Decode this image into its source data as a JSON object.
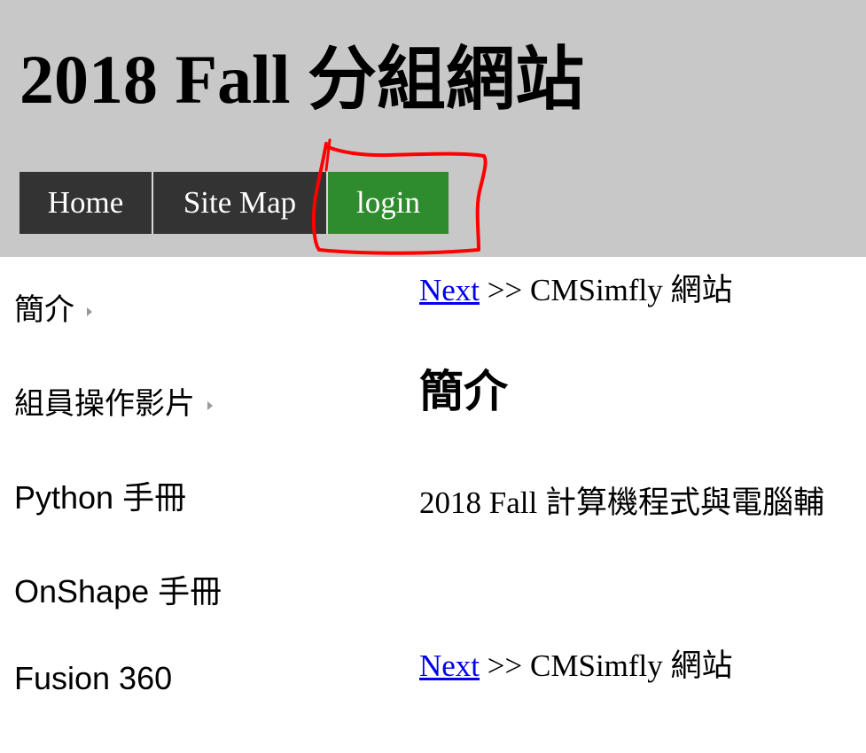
{
  "header": {
    "title": "2018 Fall 分組網站",
    "nav": [
      {
        "label": "Home"
      },
      {
        "label": "Site Map"
      },
      {
        "label": "login"
      }
    ]
  },
  "sidebar": {
    "items": [
      {
        "label": "簡介",
        "has_submenu": true
      },
      {
        "label": "組員操作影片",
        "has_submenu": true
      },
      {
        "label": "Python 手冊",
        "has_submenu": false
      },
      {
        "label": "OnShape 手冊",
        "has_submenu": false
      },
      {
        "label": "Fusion 360",
        "has_submenu": false
      }
    ]
  },
  "content": {
    "breadcrumb_top": {
      "link": "Next",
      "text": ">> CMSimfly 網站"
    },
    "heading": "簡介",
    "body": "2018 Fall 計算機程式與電腦輔",
    "breadcrumb_bottom": {
      "link": "Next",
      "text": ">> CMSimfly 網站"
    }
  },
  "colors": {
    "header_bg": "#c8c8c8",
    "nav_bg": "#333333",
    "login_bg": "#2e8b2e",
    "link": "#0000ee",
    "annotation": "#ff0000"
  }
}
